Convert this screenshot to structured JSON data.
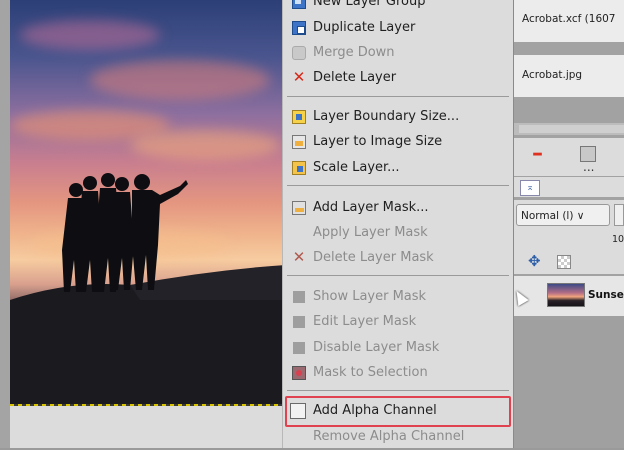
{
  "context_menu": {
    "items": [
      {
        "label": "New Layer Group",
        "enabled": true,
        "icon": "layer-group-icon"
      },
      {
        "label": "Duplicate Layer",
        "enabled": true,
        "icon": "duplicate-layer-icon"
      },
      {
        "label": "Merge Down",
        "enabled": false,
        "icon": "merge-down-icon"
      },
      {
        "label": "Delete Layer",
        "enabled": true,
        "icon": "delete-icon"
      },
      {
        "label": "Layer Boundary Size...",
        "enabled": true,
        "icon": "layer-boundary-icon"
      },
      {
        "label": "Layer to Image Size",
        "enabled": true,
        "icon": "layer-to-image-icon"
      },
      {
        "label": "Scale Layer...",
        "enabled": true,
        "icon": "scale-layer-icon"
      },
      {
        "label": "Add Layer Mask...",
        "enabled": true,
        "icon": "add-mask-icon"
      },
      {
        "label": "Apply Layer Mask",
        "enabled": false,
        "icon": ""
      },
      {
        "label": "Delete Layer Mask",
        "enabled": false,
        "icon": "delete-icon"
      },
      {
        "label": "Show Layer Mask",
        "enabled": false,
        "icon": "mask-checkbox-icon"
      },
      {
        "label": "Edit Layer Mask",
        "enabled": false,
        "icon": "mask-checkbox-icon"
      },
      {
        "label": "Disable Layer Mask",
        "enabled": false,
        "icon": "mask-checkbox-icon"
      },
      {
        "label": "Mask to Selection",
        "enabled": false,
        "icon": "mask-to-selection-icon"
      },
      {
        "label": "Add Alpha Channel",
        "enabled": true,
        "highlighted": true,
        "icon": "checkbox-icon"
      },
      {
        "label": "Remove Alpha Channel",
        "enabled": false,
        "icon": ""
      }
    ],
    "highlight_color": "#e0434f"
  },
  "image_tabs": [
    {
      "label": "Acrobat.xcf (1607"
    },
    {
      "label": "Acrobat.jpg"
    }
  ],
  "layers_panel": {
    "mode": "Normal (l)",
    "opacity_partial": "10",
    "layer_name": "Sunse",
    "toolbar_dots": "..."
  }
}
